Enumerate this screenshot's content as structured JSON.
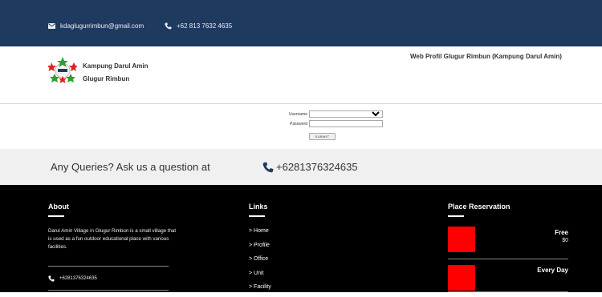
{
  "topbar": {
    "email": "kdaglugurrimbun@gmail.com",
    "phone": "+62 813 7632 4635"
  },
  "header": {
    "brand_line1": "Kampung Darul Amin",
    "brand_line2": "Glugur Rimbun",
    "site_title": "Web Profil Glugur Rimbun (Kampung Darul Amin)"
  },
  "login": {
    "username_label": "Username",
    "password_label": "Password",
    "username_value": "",
    "submit_label": "SUBMIT"
  },
  "queries": {
    "text": "Any Queries? Ask us a question at",
    "phone": "+6281376324635"
  },
  "footer": {
    "about": {
      "title": "About",
      "text": "Darul Amin Village in Glugur Rimbun is a small village that is used as a fun outdoor educational place with various facilities.",
      "phone": "+6281376324635"
    },
    "links": {
      "title": "Links",
      "items": [
        "Home",
        "Profile",
        "Office",
        "Unit",
        "Facility"
      ]
    },
    "reservation": {
      "title": "Place Reservation",
      "items": [
        {
          "name": "Free",
          "price": "$0"
        },
        {
          "name": "Every Day",
          "price": ""
        }
      ]
    }
  },
  "colors": {
    "topbar": "#1f3a5f",
    "footer": "#000000",
    "accent": "#ff0000",
    "queries_bg": "#f0f0f0"
  }
}
